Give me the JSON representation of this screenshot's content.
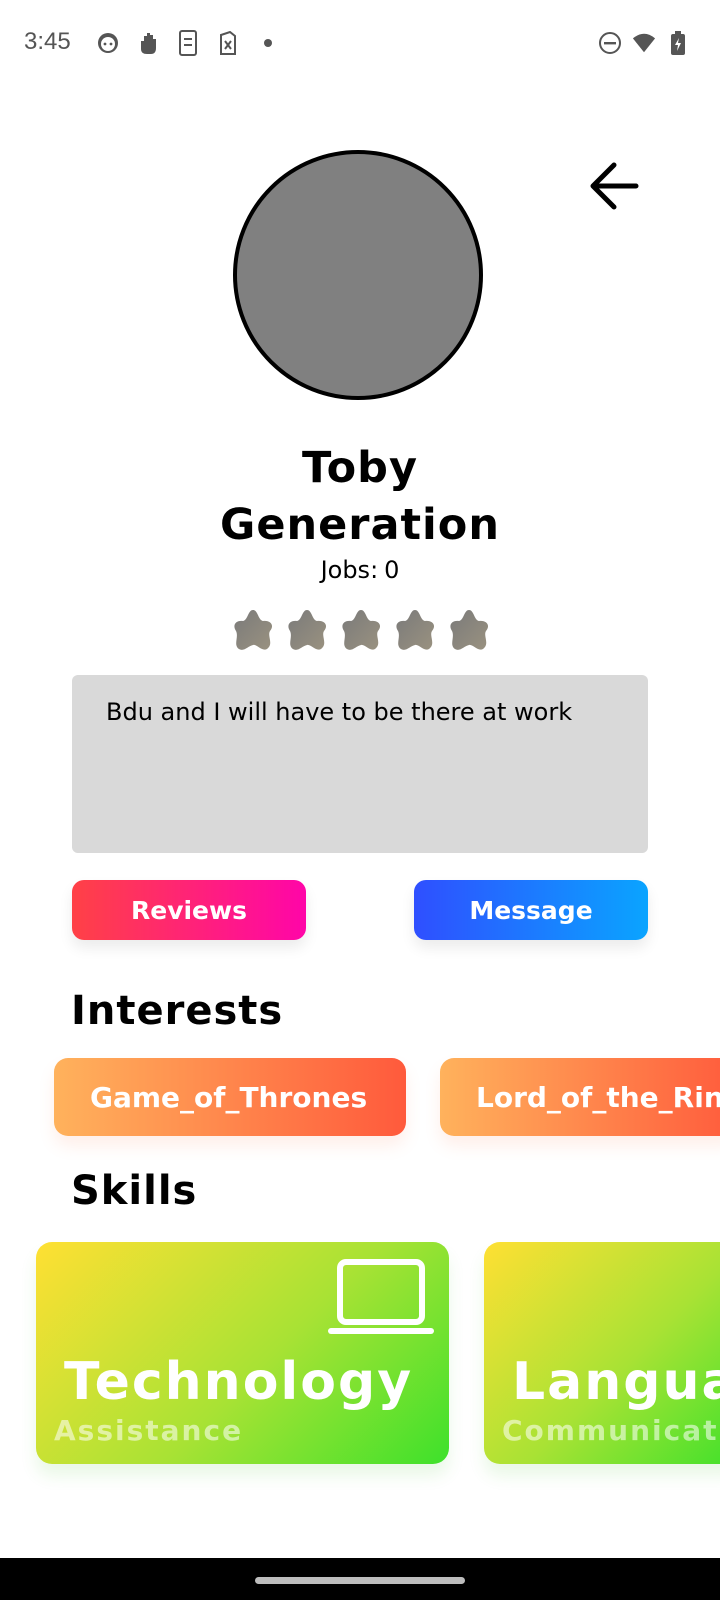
{
  "status_bar": {
    "time": "3:45",
    "left_icons": [
      "face-icon",
      "hand-icon",
      "clipboard-icon",
      "sim-off-icon",
      "dot-icon"
    ],
    "right_icons": [
      "do-not-disturb-icon",
      "wifi-icon",
      "battery-icon"
    ]
  },
  "profile": {
    "first_name": "Toby",
    "last_name": "Generation",
    "jobs_label": "Jobs:",
    "jobs_count": "0",
    "rating_stars": 5,
    "bio": "Bdu and I will have to be there at work"
  },
  "actions": {
    "reviews_label": "Reviews",
    "message_label": "Message"
  },
  "interests": {
    "title": "Interests",
    "items": [
      "Game_of_Thrones",
      "Lord_of_the_Rin"
    ]
  },
  "skills": {
    "title": "Skills",
    "items": [
      {
        "title": "Technology",
        "subtitle": "Assistance",
        "icon": "laptop-icon"
      },
      {
        "title": "Languag",
        "subtitle": "Communicatio",
        "icon": ""
      }
    ]
  },
  "colors": {
    "reviews_gradient": [
      "#ff4146",
      "#ff05a8"
    ],
    "message_gradient": [
      "#2f4fff",
      "#0aa4ff"
    ],
    "interest_gradient": [
      "#ffb25c",
      "#ff5a3c"
    ],
    "skill_gradient": [
      "#ffe033",
      "#a8e234",
      "#3ee12b"
    ],
    "bio_background": "#d9d9d9",
    "avatar_fill": "#808080"
  }
}
